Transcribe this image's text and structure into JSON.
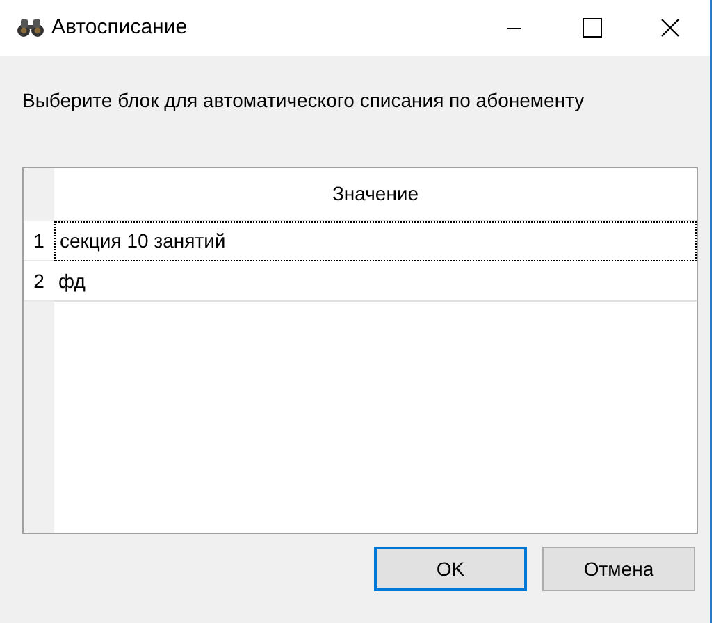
{
  "window": {
    "title": "Автосписание"
  },
  "prompt": "Выберите блок для автоматического списания по абонементу",
  "table": {
    "columns": [
      "Значение"
    ],
    "rows": [
      {
        "number": "1",
        "value": "секция 10 занятий",
        "selected": true
      },
      {
        "number": "2",
        "value": "фд",
        "selected": false
      }
    ]
  },
  "buttons": [
    {
      "label": "OK",
      "default": true
    },
    {
      "label": "Отмена",
      "default": false
    }
  ]
}
